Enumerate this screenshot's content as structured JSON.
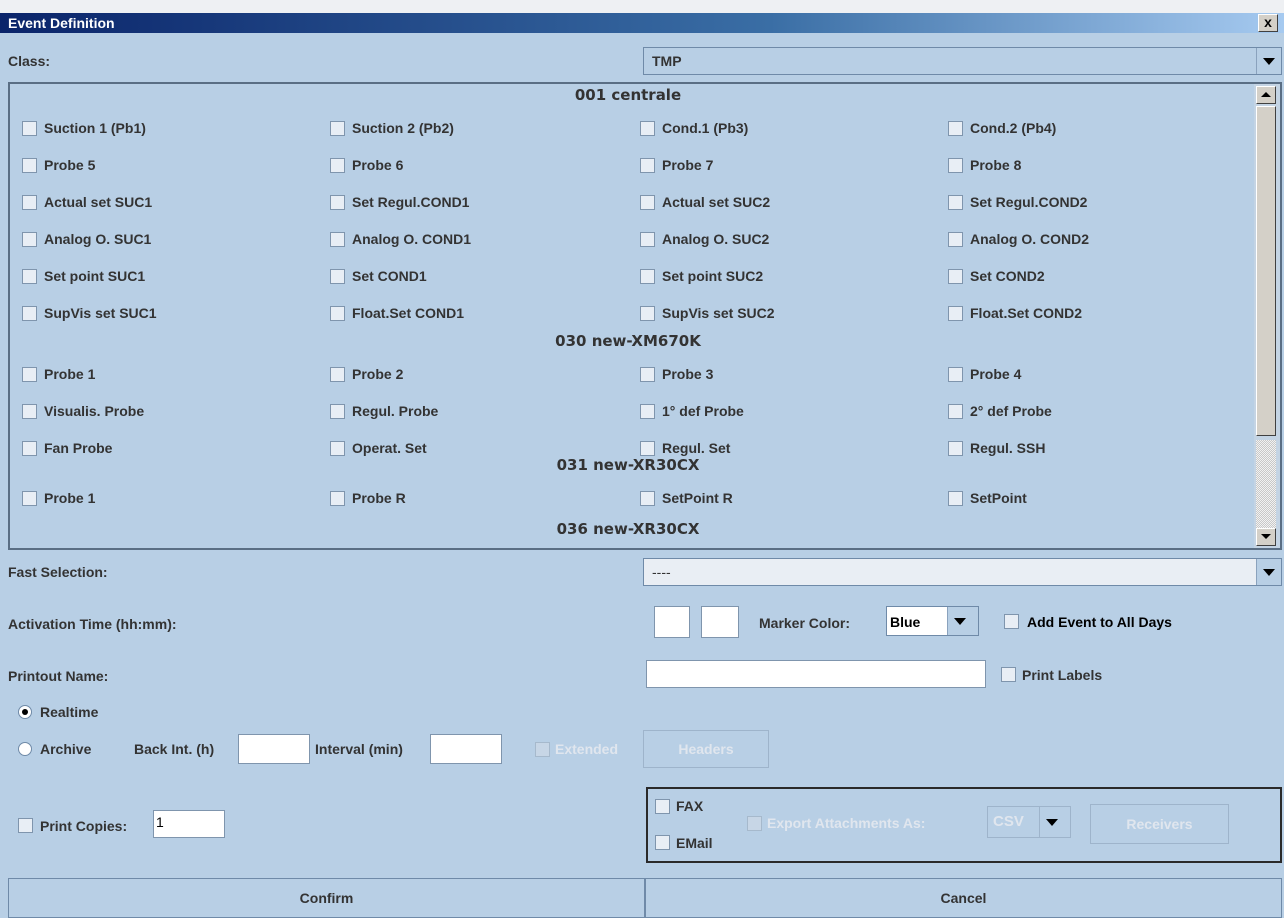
{
  "window": {
    "title": "Event Definition",
    "close_label": "x"
  },
  "class_row": {
    "label": "Class:",
    "value": "TMP"
  },
  "groups": [
    {
      "name": "001 centrale",
      "items": [
        "Suction 1 (Pb1)",
        "Suction 2 (Pb2)",
        "Cond.1 (Pb3)",
        "Cond.2 (Pb4)",
        "Probe 5",
        "Probe 6",
        "Probe 7",
        "Probe 8",
        "Actual set SUC1",
        "Set Regul.COND1",
        "Actual set SUC2",
        "Set Regul.COND2",
        "Analog O. SUC1",
        "Analog O. COND1",
        "Analog O. SUC2",
        "Analog O. COND2",
        "Set point SUC1",
        "Set COND1",
        "Set point SUC2",
        "Set COND2",
        "SupVis set SUC1",
        "Float.Set COND1",
        "SupVis set SUC2",
        "Float.Set COND2"
      ]
    },
    {
      "name": "030 new-XM670K",
      "items": [
        "Probe 1",
        "Probe 2",
        "Probe 3",
        "Probe 4",
        "Visualis. Probe",
        "Regul. Probe",
        "1° def Probe",
        "2° def Probe",
        "Fan Probe",
        "Operat. Set",
        "Regul. Set",
        "Regul. SSH"
      ]
    },
    {
      "name": "031 new-XR30CX",
      "items": [
        "Probe 1",
        "Probe R",
        "SetPoint R",
        "SetPoint"
      ]
    },
    {
      "name": "036 new-XR30CX",
      "items": []
    }
  ],
  "fast_selection": {
    "label": "Fast Selection:",
    "value": "----"
  },
  "activation": {
    "label": "Activation Time (hh:mm):",
    "hh": "",
    "mm": ""
  },
  "marker": {
    "label": "Marker Color:",
    "value": "Blue"
  },
  "all_days": {
    "label": "Add Event to All Days"
  },
  "printout": {
    "label": "Printout Name:",
    "value": ""
  },
  "print_labels": {
    "label": "Print Labels"
  },
  "mode": {
    "realtime": "Realtime",
    "archive": "Archive",
    "selected": "Realtime"
  },
  "back_int": {
    "label": "Back Int. (h)",
    "value": ""
  },
  "interval": {
    "label": "Interval (min)",
    "value": ""
  },
  "extended": {
    "label": "Extended"
  },
  "headers_button": "Headers",
  "print_copies": {
    "label": "Print Copies:",
    "value": "1"
  },
  "fax": {
    "label": "FAX"
  },
  "email": {
    "label": "EMail"
  },
  "export": {
    "label": "Export Attachments As:",
    "value": "CSV"
  },
  "receivers_button": "Receivers",
  "confirm_button": "Confirm",
  "cancel_button": "Cancel"
}
